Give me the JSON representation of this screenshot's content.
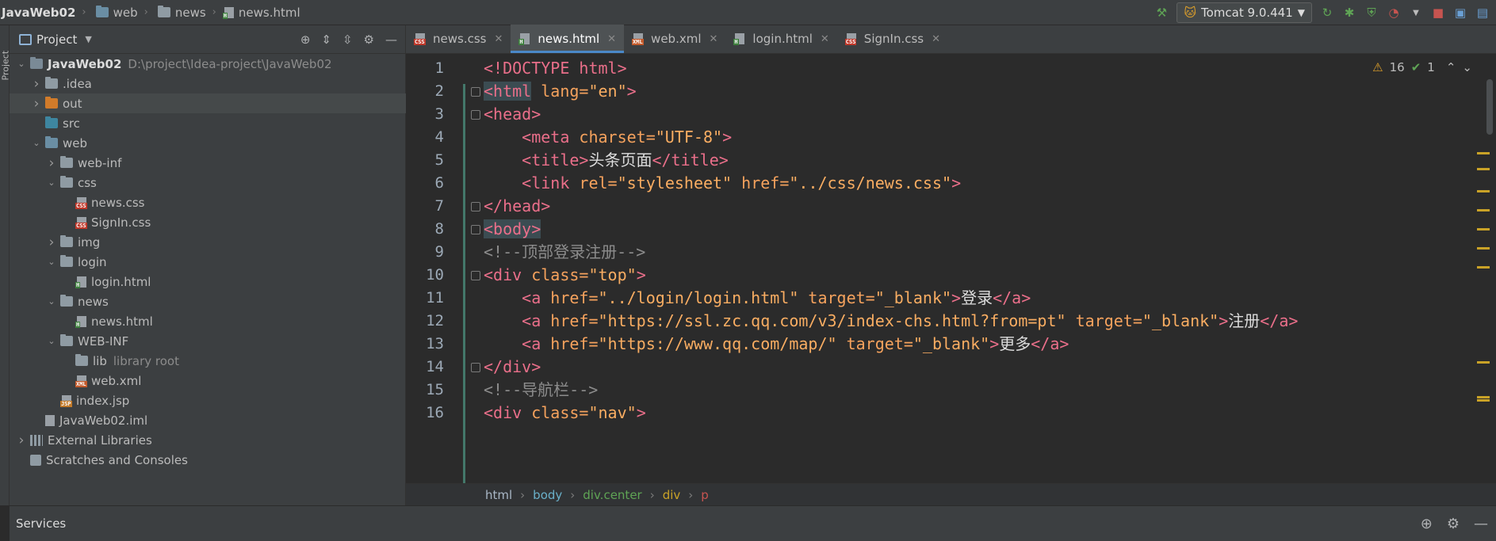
{
  "breadcrumbs": [
    "JavaWeb02",
    "web",
    "news",
    "news.html"
  ],
  "run_config": "Tomcat 9.0.441",
  "project_panel": {
    "title": "Project",
    "tree": [
      {
        "label": "JavaWeb02",
        "hint": "D:\\project\\Idea-project\\JavaWeb02",
        "depth": 0,
        "arrow": "down",
        "icon": "module-folder-icon"
      },
      {
        "label": ".idea",
        "depth": 1,
        "arrow": "right",
        "icon": "folder-icon"
      },
      {
        "label": "out",
        "depth": 1,
        "arrow": "right",
        "icon": "excluded-folder-icon"
      },
      {
        "label": "src",
        "depth": 1,
        "arrow": "",
        "icon": "source-folder-icon"
      },
      {
        "label": "web",
        "depth": 1,
        "arrow": "down",
        "icon": "web-folder-icon"
      },
      {
        "label": "web-inf",
        "depth": 2,
        "arrow": "right",
        "icon": "folder-icon"
      },
      {
        "label": "css",
        "depth": 2,
        "arrow": "down",
        "icon": "folder-icon"
      },
      {
        "label": "news.css",
        "depth": 3,
        "arrow": "",
        "icon": "css-file-icon"
      },
      {
        "label": "SignIn.css",
        "depth": 3,
        "arrow": "",
        "icon": "css-file-icon"
      },
      {
        "label": "img",
        "depth": 2,
        "arrow": "right",
        "icon": "folder-icon"
      },
      {
        "label": "login",
        "depth": 2,
        "arrow": "down",
        "icon": "folder-icon"
      },
      {
        "label": "login.html",
        "depth": 3,
        "arrow": "",
        "icon": "html-file-icon"
      },
      {
        "label": "news",
        "depth": 2,
        "arrow": "down",
        "icon": "folder-icon"
      },
      {
        "label": "news.html",
        "depth": 3,
        "arrow": "",
        "icon": "html-file-icon"
      },
      {
        "label": "WEB-INF",
        "depth": 2,
        "arrow": "down",
        "icon": "folder-icon"
      },
      {
        "label": "lib",
        "hint": "library root",
        "depth": 3,
        "arrow": "",
        "icon": "folder-icon"
      },
      {
        "label": "web.xml",
        "depth": 3,
        "arrow": "",
        "icon": "xml-file-icon"
      },
      {
        "label": "index.jsp",
        "depth": 2,
        "arrow": "",
        "icon": "jsp-file-icon"
      },
      {
        "label": "JavaWeb02.iml",
        "depth": 1,
        "arrow": "",
        "icon": "iml-file-icon"
      },
      {
        "label": "External Libraries",
        "depth": 0,
        "arrow": "right",
        "icon": "libraries-icon"
      },
      {
        "label": "Scratches and Consoles",
        "depth": 0,
        "arrow": "",
        "icon": "scratches-icon"
      }
    ]
  },
  "tabs": [
    {
      "label": "news.css",
      "type": "CSS",
      "active": false
    },
    {
      "label": "news.html",
      "type": "H",
      "active": true
    },
    {
      "label": "web.xml",
      "type": "XML",
      "active": false
    },
    {
      "label": "login.html",
      "type": "H",
      "active": false
    },
    {
      "label": "SignIn.css",
      "type": "CSS",
      "active": false
    }
  ],
  "inspections": {
    "warnings": "16",
    "ok": "1"
  },
  "code_lines": [
    {
      "n": "1",
      "parts": [
        [
          "tg",
          "<!DOCTYPE html>"
        ]
      ]
    },
    {
      "n": "2",
      "parts": [
        [
          "tg",
          "<html"
        ],
        [
          "at",
          " lang="
        ],
        [
          "sv",
          "\"en\""
        ],
        [
          "tg",
          ">"
        ]
      ]
    },
    {
      "n": "3",
      "parts": [
        [
          "tg",
          "<head>"
        ]
      ]
    },
    {
      "n": "4",
      "parts": [
        [
          "tx",
          "    "
        ],
        [
          "tg",
          "<meta"
        ],
        [
          "at",
          " charset="
        ],
        [
          "sv",
          "\"UTF-8\""
        ],
        [
          "tg",
          ">"
        ]
      ]
    },
    {
      "n": "5",
      "parts": [
        [
          "tx",
          "    "
        ],
        [
          "tg",
          "<title>"
        ],
        [
          "tx",
          "头条页面"
        ],
        [
          "tg",
          "</title>"
        ]
      ]
    },
    {
      "n": "6",
      "parts": [
        [
          "tx",
          "    "
        ],
        [
          "tg",
          "<link"
        ],
        [
          "at",
          " rel="
        ],
        [
          "sv",
          "\"stylesheet\""
        ],
        [
          "at",
          " href="
        ],
        [
          "sv",
          "\"../css/news.css\""
        ],
        [
          "tg",
          ">"
        ]
      ]
    },
    {
      "n": "7",
      "parts": [
        [
          "tg",
          "</head>"
        ]
      ]
    },
    {
      "n": "8",
      "parts": [
        [
          "tg",
          "<body>"
        ]
      ]
    },
    {
      "n": "9",
      "parts": [
        [
          "cm",
          "<!--顶部登录注册-->"
        ]
      ]
    },
    {
      "n": "10",
      "parts": [
        [
          "tg",
          "<div"
        ],
        [
          "at",
          " class="
        ],
        [
          "sv",
          "\"top\""
        ],
        [
          "tg",
          ">"
        ]
      ]
    },
    {
      "n": "11",
      "parts": [
        [
          "tx",
          "    "
        ],
        [
          "tg",
          "<a"
        ],
        [
          "at",
          " href="
        ],
        [
          "sv",
          "\"../login/login.html\""
        ],
        [
          "at",
          " target="
        ],
        [
          "sv",
          "\"_blank\""
        ],
        [
          "tg",
          ">"
        ],
        [
          "tx",
          "登录"
        ],
        [
          "tg",
          "</a>"
        ]
      ]
    },
    {
      "n": "12",
      "parts": [
        [
          "tx",
          "    "
        ],
        [
          "tg",
          "<a"
        ],
        [
          "at",
          " href="
        ],
        [
          "sv",
          "\"https://ssl.zc.qq.com/v3/index-chs.html?from=pt\""
        ],
        [
          "at",
          " target="
        ],
        [
          "sv",
          "\"_blank\""
        ],
        [
          "tg",
          ">"
        ],
        [
          "tx",
          "注册"
        ],
        [
          "tg",
          "</a>"
        ]
      ]
    },
    {
      "n": "13",
      "parts": [
        [
          "tx",
          "    "
        ],
        [
          "tg",
          "<a"
        ],
        [
          "at",
          " href="
        ],
        [
          "sv",
          "\"https://www.qq.com/map/\""
        ],
        [
          "at",
          " target="
        ],
        [
          "sv",
          "\"_blank\""
        ],
        [
          "tg",
          ">"
        ],
        [
          "tx",
          "更多"
        ],
        [
          "tg",
          "</a>"
        ]
      ]
    },
    {
      "n": "14",
      "parts": [
        [
          "tg",
          "</div>"
        ]
      ]
    },
    {
      "n": "15",
      "parts": [
        [
          "cm",
          "<!--导航栏-->"
        ]
      ]
    },
    {
      "n": "16",
      "parts": [
        [
          "tg",
          "<div"
        ],
        [
          "at",
          " class="
        ],
        [
          "sv",
          "\"nav\""
        ],
        [
          "tg",
          ">"
        ]
      ]
    }
  ],
  "editor_breadcrumb": [
    "html",
    "body",
    "div.center",
    "div",
    "p"
  ],
  "services": {
    "title": "Services"
  },
  "colors": {
    "accent": "#4a88c7",
    "tag": "#ea6f8a",
    "attr_value": "#f9ad62"
  }
}
